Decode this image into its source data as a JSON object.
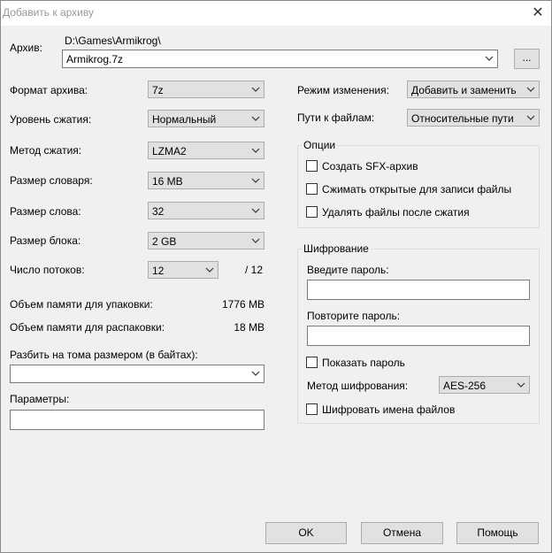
{
  "window": {
    "title": "Добавить к архиву",
    "close_glyph": "✕"
  },
  "archive": {
    "label": "Архив:",
    "path": "D:\\Games\\Armikrog\\",
    "name": "Armikrog.7z",
    "browse_label": "..."
  },
  "format": {
    "label": "Формат архива:",
    "value": "7z"
  },
  "level": {
    "label": "Уровень сжатия:",
    "value": "Нормальный"
  },
  "method": {
    "label": "Метод сжатия:",
    "value": "LZMA2"
  },
  "dict": {
    "label": "Размер словаря:",
    "value": "16 MB"
  },
  "word": {
    "label": "Размер слова:",
    "value": "32"
  },
  "block": {
    "label": "Размер блока:",
    "value": "2 GB"
  },
  "threads": {
    "label": "Число потоков:",
    "value": "12",
    "max": "/ 12"
  },
  "memory": {
    "pack_label": "Объем памяти для упаковки:",
    "pack_value": "1776 MB",
    "unpack_label": "Объем памяти для распаковки:",
    "unpack_value": "18 MB"
  },
  "split": {
    "label": "Разбить на тома размером (в байтах):",
    "value": ""
  },
  "params": {
    "label": "Параметры:",
    "value": ""
  },
  "update_mode": {
    "label": "Режим изменения:",
    "value": "Добавить и заменить"
  },
  "path_mode": {
    "label": "Пути к файлам:",
    "value": "Относительные пути"
  },
  "options": {
    "title": "Опции",
    "sfx": "Создать SFX-архив",
    "shared": "Сжимать открытые для записи файлы",
    "delete": "Удалять файлы после сжатия"
  },
  "encryption": {
    "title": "Шифрование",
    "enter_label": "Введите пароль:",
    "repeat_label": "Повторите пароль:",
    "show": "Показать пароль",
    "method_label": "Метод шифрования:",
    "method_value": "AES-256",
    "encrypt_names": "Шифровать имена файлов"
  },
  "buttons": {
    "ok": "OK",
    "cancel": "Отмена",
    "help": "Помощь"
  }
}
